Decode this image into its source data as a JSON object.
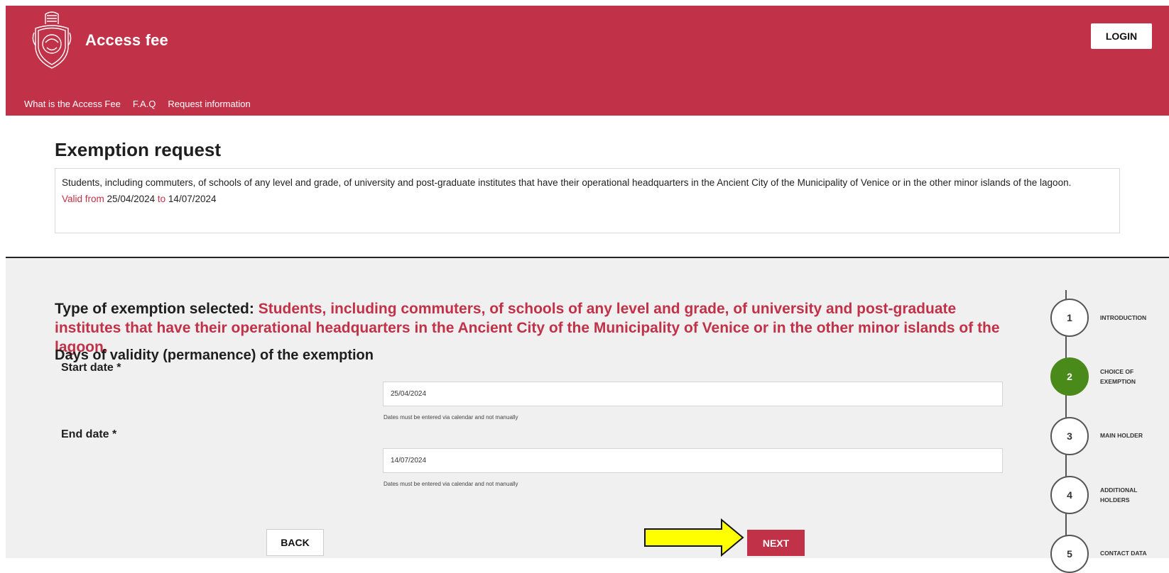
{
  "header": {
    "site_title": "Access fee",
    "login_label": "LOGIN",
    "nav": [
      "What is the Access Fee",
      "F.A.Q",
      "Request information"
    ],
    "background_color": "#c13147"
  },
  "intro": {
    "title": "Exemption request",
    "description": "Students, including commuters, of schools of any level and grade, of university and post-graduate institutes that have their operational headquarters in the Ancient City of the Municipality of Venice or in the other minor islands of the lagoon.",
    "valid_from_label": "Valid from",
    "valid_from": "25/04/2024",
    "to_label": "to",
    "valid_to": "14/07/2024"
  },
  "form": {
    "type_label": "Type of exemption selected:",
    "type_value": "Students, including commuters, of schools of any level and grade, of university and post-graduate institutes that have their operational headquarters in the Ancient City of the Municipality of Venice or in the other minor islands of the lagoon.",
    "days_heading": "Days of validity (permanence) of the exemption",
    "start_label": "Start date *",
    "start_value": "25/04/2024",
    "end_label": "End date *",
    "end_value": "14/07/2024",
    "hint": "Dates must be entered via calendar and not manually",
    "back_label": "BACK",
    "next_label": "NEXT"
  },
  "steps": [
    {
      "number": "1",
      "label": "INTRODUCTION",
      "active": false
    },
    {
      "number": "2",
      "label": "CHOICE OF EXEMPTION",
      "active": true
    },
    {
      "number": "3",
      "label": "MAIN HOLDER",
      "active": false
    },
    {
      "number": "4",
      "label": "ADDITIONAL HOLDERS",
      "active": false
    },
    {
      "number": "5",
      "label": "CONTACT DATA",
      "active": false
    }
  ],
  "colors": {
    "accent": "#c13147",
    "active_step": "#4a8a1a",
    "arrow": "#ffff00"
  },
  "icons": {
    "logo": "venice-coat-of-arms-icon",
    "pointer": "yellow-arrow-icon"
  }
}
